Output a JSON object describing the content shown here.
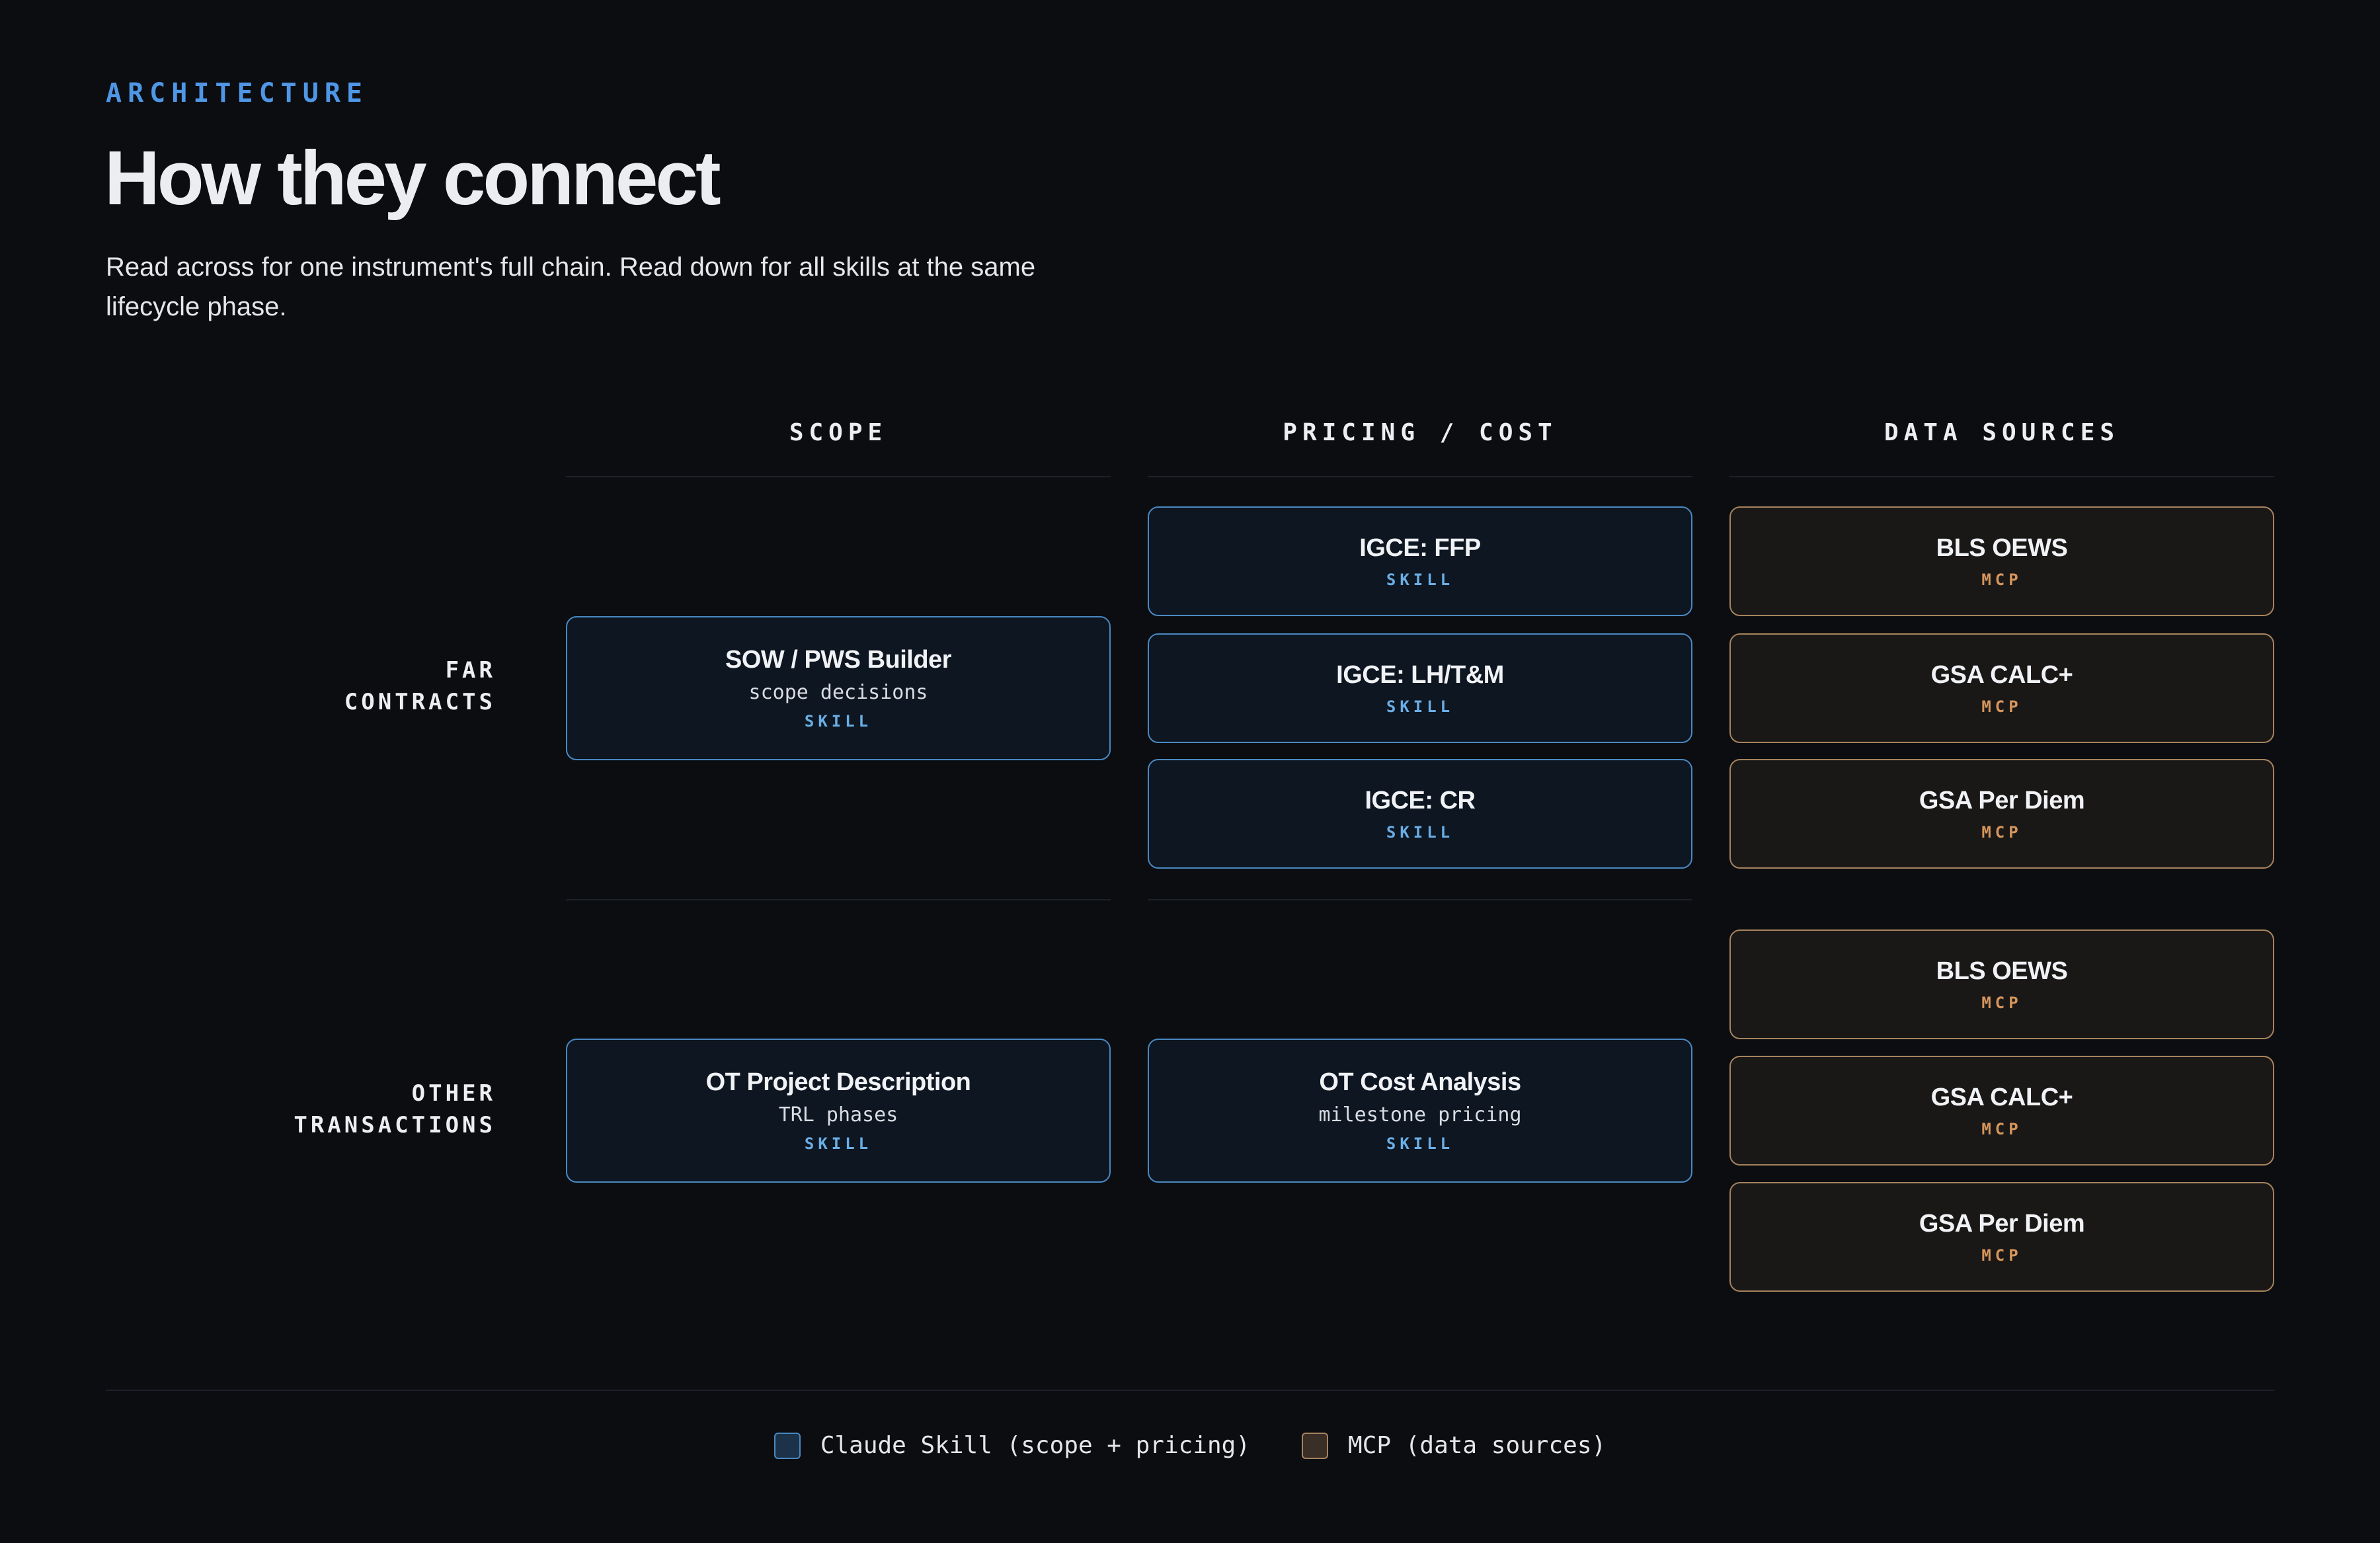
{
  "header": {
    "eyebrow": "ARCHITECTURE",
    "title": "How they connect",
    "subtitle": "Read across for one instrument's full chain. Read down for all skills at the same lifecycle phase."
  },
  "columns": [
    "SCOPE",
    "PRICING / COST",
    "DATA SOURCES"
  ],
  "rows": [
    {
      "label_line1": "FAR",
      "label_line2": "CONTRACTS",
      "scope": {
        "title": "SOW / PWS Builder",
        "desc": "scope decisions",
        "tag": "SKILL"
      },
      "pricing": [
        {
          "title": "IGCE: FFP",
          "tag": "SKILL"
        },
        {
          "title": "IGCE: LH/T&M",
          "tag": "SKILL"
        },
        {
          "title": "IGCE: CR",
          "tag": "SKILL"
        }
      ],
      "sources": [
        {
          "title": "BLS OEWS",
          "tag": "MCP"
        },
        {
          "title": "GSA CALC+",
          "tag": "MCP"
        },
        {
          "title": "GSA Per Diem",
          "tag": "MCP"
        }
      ]
    },
    {
      "label_line1": "OTHER",
      "label_line2": "TRANSACTIONS",
      "scope": {
        "title": "OT Project Description",
        "desc": "TRL phases",
        "tag": "SKILL"
      },
      "pricing": [
        {
          "title": "OT Cost Analysis",
          "desc": "milestone pricing",
          "tag": "SKILL"
        }
      ],
      "sources": [
        {
          "title": "BLS OEWS",
          "tag": "MCP"
        },
        {
          "title": "GSA CALC+",
          "tag": "MCP"
        },
        {
          "title": "GSA Per Diem",
          "tag": "MCP"
        }
      ]
    }
  ],
  "legend": {
    "skill": "Claude Skill (scope + pricing)",
    "mcp": "MCP (data sources)"
  },
  "colors": {
    "accent": "#4f97e6",
    "skill_border": "#4a88c2",
    "mcp_border": "#a6835d",
    "background": "#0b0d11"
  }
}
